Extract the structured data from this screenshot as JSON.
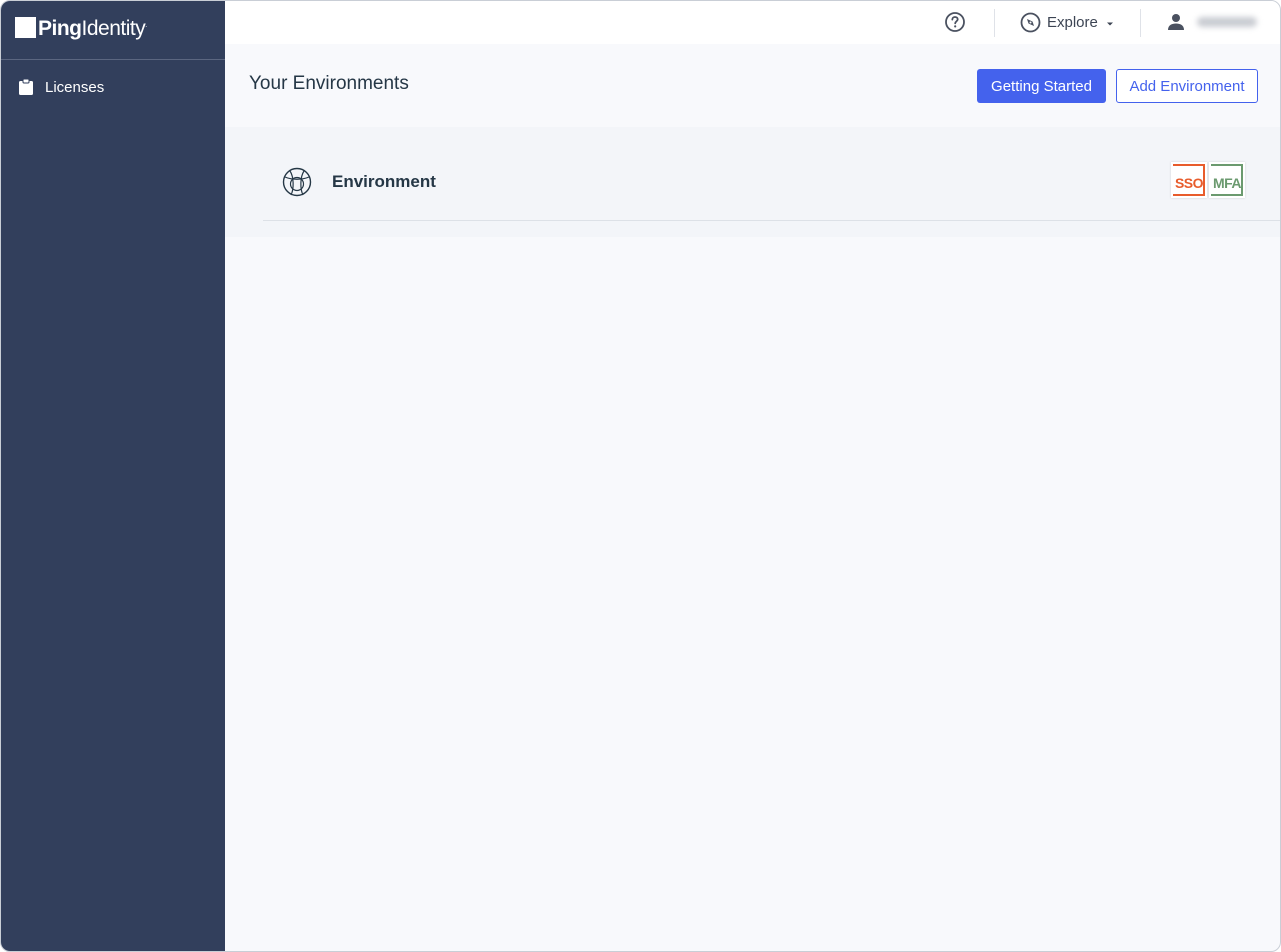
{
  "brand": {
    "name_bold": "Ping",
    "name_light": "Identity",
    "mark": "."
  },
  "sidebar": {
    "items": [
      {
        "label": "Licenses",
        "icon": "clipboard-icon"
      }
    ]
  },
  "topbar": {
    "help_icon": "help-circle-icon",
    "explore_label": "Explore",
    "explore_icon": "compass-icon",
    "user_icon": "user-icon"
  },
  "page": {
    "title": "Your Environments",
    "getting_started_label": "Getting Started",
    "add_environment_label": "Add Environment"
  },
  "environments": [
    {
      "name": "Environment",
      "icon": "globe-icon",
      "badges": [
        {
          "label": "SSO",
          "color": "#e85c2c"
        },
        {
          "label": "MFA",
          "color": "#6b9a6f"
        }
      ]
    }
  ],
  "colors": {
    "sidebar_bg": "#323f5c",
    "accent": "#4462ed"
  }
}
